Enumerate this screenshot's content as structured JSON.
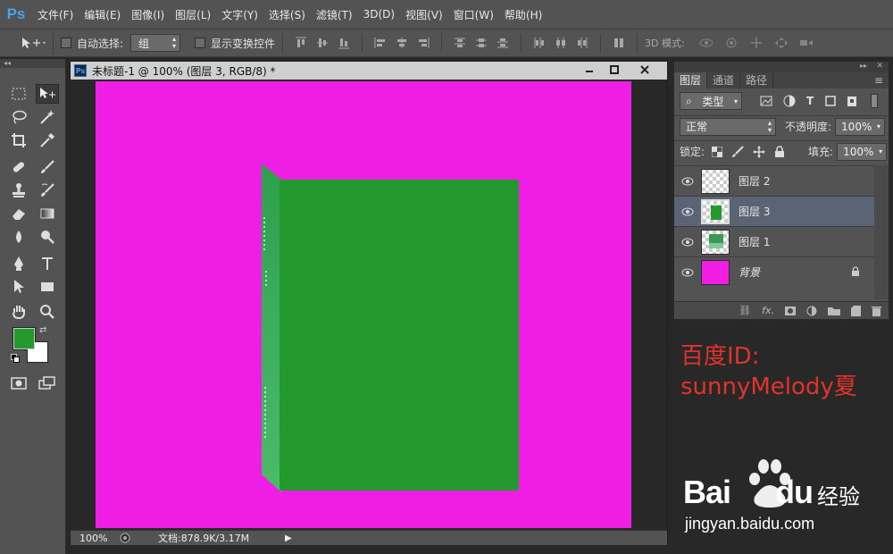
{
  "app": {
    "logo": "Ps"
  },
  "menu": [
    "文件(F)",
    "编辑(E)",
    "图像(I)",
    "图层(L)",
    "文字(Y)",
    "选择(S)",
    "滤镜(T)",
    "3D(D)",
    "视图(V)",
    "窗口(W)",
    "帮助(H)"
  ],
  "options": {
    "auto_select_label": "自动选择:",
    "auto_select_value": "组",
    "show_transform_label": "显示变换控件",
    "mode3d_label": "3D 模式:"
  },
  "document": {
    "title": "未标题-1 @ 100% (图层 3, RGB/8) *",
    "zoom": "100%",
    "doc_info": "文档:878.9K/3.17M"
  },
  "layers_panel": {
    "tabs": [
      "图层",
      "通道",
      "路径"
    ],
    "filter_kind": "类型",
    "blend_mode": "正常",
    "opacity_label": "不透明度:",
    "opacity_value": "100%",
    "lock_label": "锁定:",
    "fill_label": "填充:",
    "fill_value": "100%",
    "layers": [
      {
        "name": "图层 2",
        "selected": false
      },
      {
        "name": "图层 3",
        "selected": true
      },
      {
        "name": "图层 1",
        "selected": false
      },
      {
        "name": "背景",
        "selected": false,
        "locked": true
      }
    ]
  },
  "watermark": {
    "line1": "百度ID:",
    "line2": "sunnyMelody夏",
    "baidu_logo": "Bai",
    "baidu_logo_du": "du",
    "baidu_jingyan": "经验",
    "baidu_url": "jingyan.baidu.com"
  },
  "colors": {
    "canvas_bg": "#f01ee4",
    "foreground": "#249a2e",
    "background": "#ffffff",
    "watermark": "#e2332b"
  }
}
